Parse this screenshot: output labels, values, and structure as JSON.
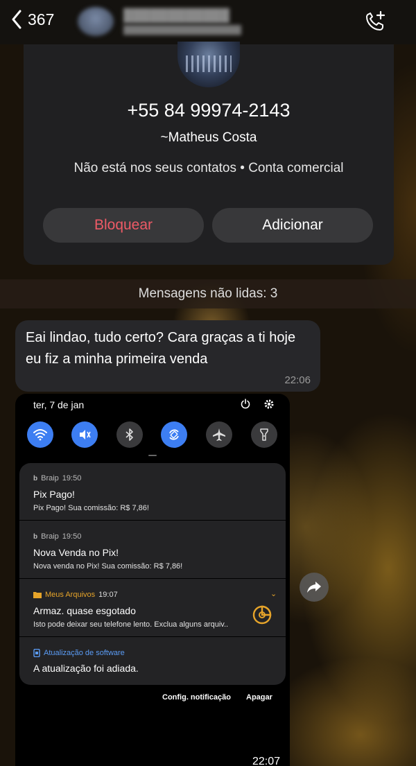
{
  "nav": {
    "back_count": "367"
  },
  "contact": {
    "phone": "+55 84 99974-2143",
    "name": "~Matheus Costa",
    "status": "Não está nos seus contatos • Conta comercial",
    "block_label": "Bloquear",
    "add_label": "Adicionar"
  },
  "unread_label": "Mensagens não lidas: 3",
  "message": {
    "text": "Eai lindao, tudo certo? Cara graças a ti hoje eu fiz a minha primeira venda",
    "time": "22:06"
  },
  "image_message": {
    "time": "22:07",
    "shade": {
      "date": "ter, 7 de jan",
      "quick_settings": [
        {
          "icon": "wifi-icon",
          "on": true
        },
        {
          "icon": "mute-icon",
          "on": true
        },
        {
          "icon": "bluetooth-icon",
          "on": false
        },
        {
          "icon": "auto-rotate-icon",
          "on": true
        },
        {
          "icon": "airplane-icon",
          "on": false
        },
        {
          "icon": "flashlight-icon",
          "on": false
        }
      ],
      "notifications": [
        {
          "app": "Braip",
          "time": "19:50",
          "title": "Pix Pago!",
          "body": "Pix Pago! Sua comissão: R$ 7,86!"
        },
        {
          "app": "Braip",
          "time": "19:50",
          "title": "Nova Venda no Pix!",
          "body": "Nova venda no Pix! Sua comissão: R$ 7,86!"
        },
        {
          "app": "Meus Arquivos",
          "time": "19:07",
          "title": "Armaz. quase esgotado",
          "body": "Isto pode deixar seu telefone lento. Exclua alguns arquiv.."
        },
        {
          "app": "Atualização de software",
          "time": "",
          "title": "A atualização foi adiada.",
          "body": ""
        }
      ],
      "actions": {
        "settings": "Config. notificação",
        "clear": "Apagar"
      }
    }
  },
  "colors": {
    "accent_blue": "#3d7ef2",
    "block_red": "#ee5a66",
    "files_orange": "#e6a42a"
  }
}
